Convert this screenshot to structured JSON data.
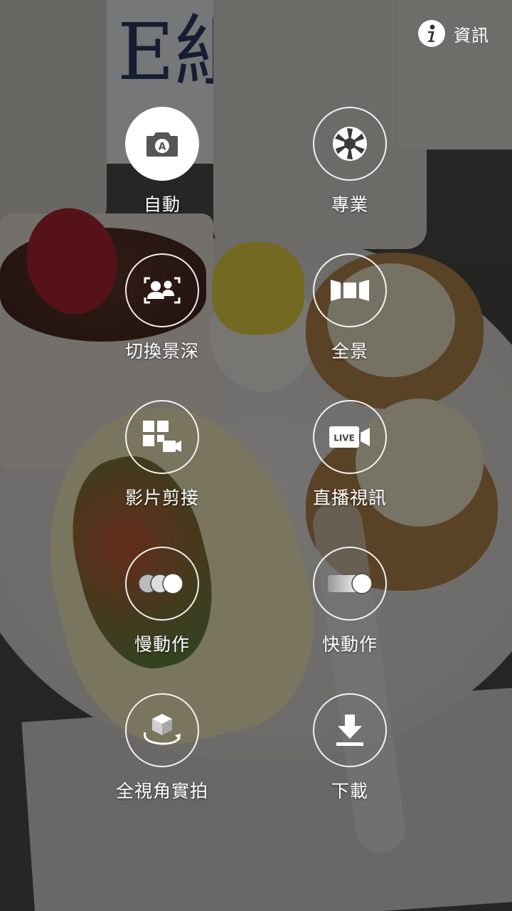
{
  "header": {
    "info_label": "資訊",
    "info_icon": "info-icon"
  },
  "background_card_text": "E組",
  "modes": [
    {
      "label": "自動",
      "icon": "auto-camera-icon",
      "selected": true
    },
    {
      "label": "專業",
      "icon": "aperture-icon",
      "selected": false
    },
    {
      "label": "切換景深",
      "icon": "selective-focus-icon",
      "selected": false
    },
    {
      "label": "全景",
      "icon": "panorama-icon",
      "selected": false
    },
    {
      "label": "影片剪接",
      "icon": "video-collage-icon",
      "selected": false
    },
    {
      "label": "直播視訊",
      "icon": "live-broadcast-icon",
      "selected": false,
      "badge": "LIVE"
    },
    {
      "label": "慢動作",
      "icon": "slow-motion-icon",
      "selected": false
    },
    {
      "label": "快動作",
      "icon": "hyperlapse-icon",
      "selected": false
    },
    {
      "label": "全視角實拍",
      "icon": "virtual-shot-icon",
      "selected": false
    },
    {
      "label": "下載",
      "icon": "download-icon",
      "selected": false
    }
  ],
  "colors": {
    "accent": "#ffffff",
    "selected_icon": "#555555"
  }
}
